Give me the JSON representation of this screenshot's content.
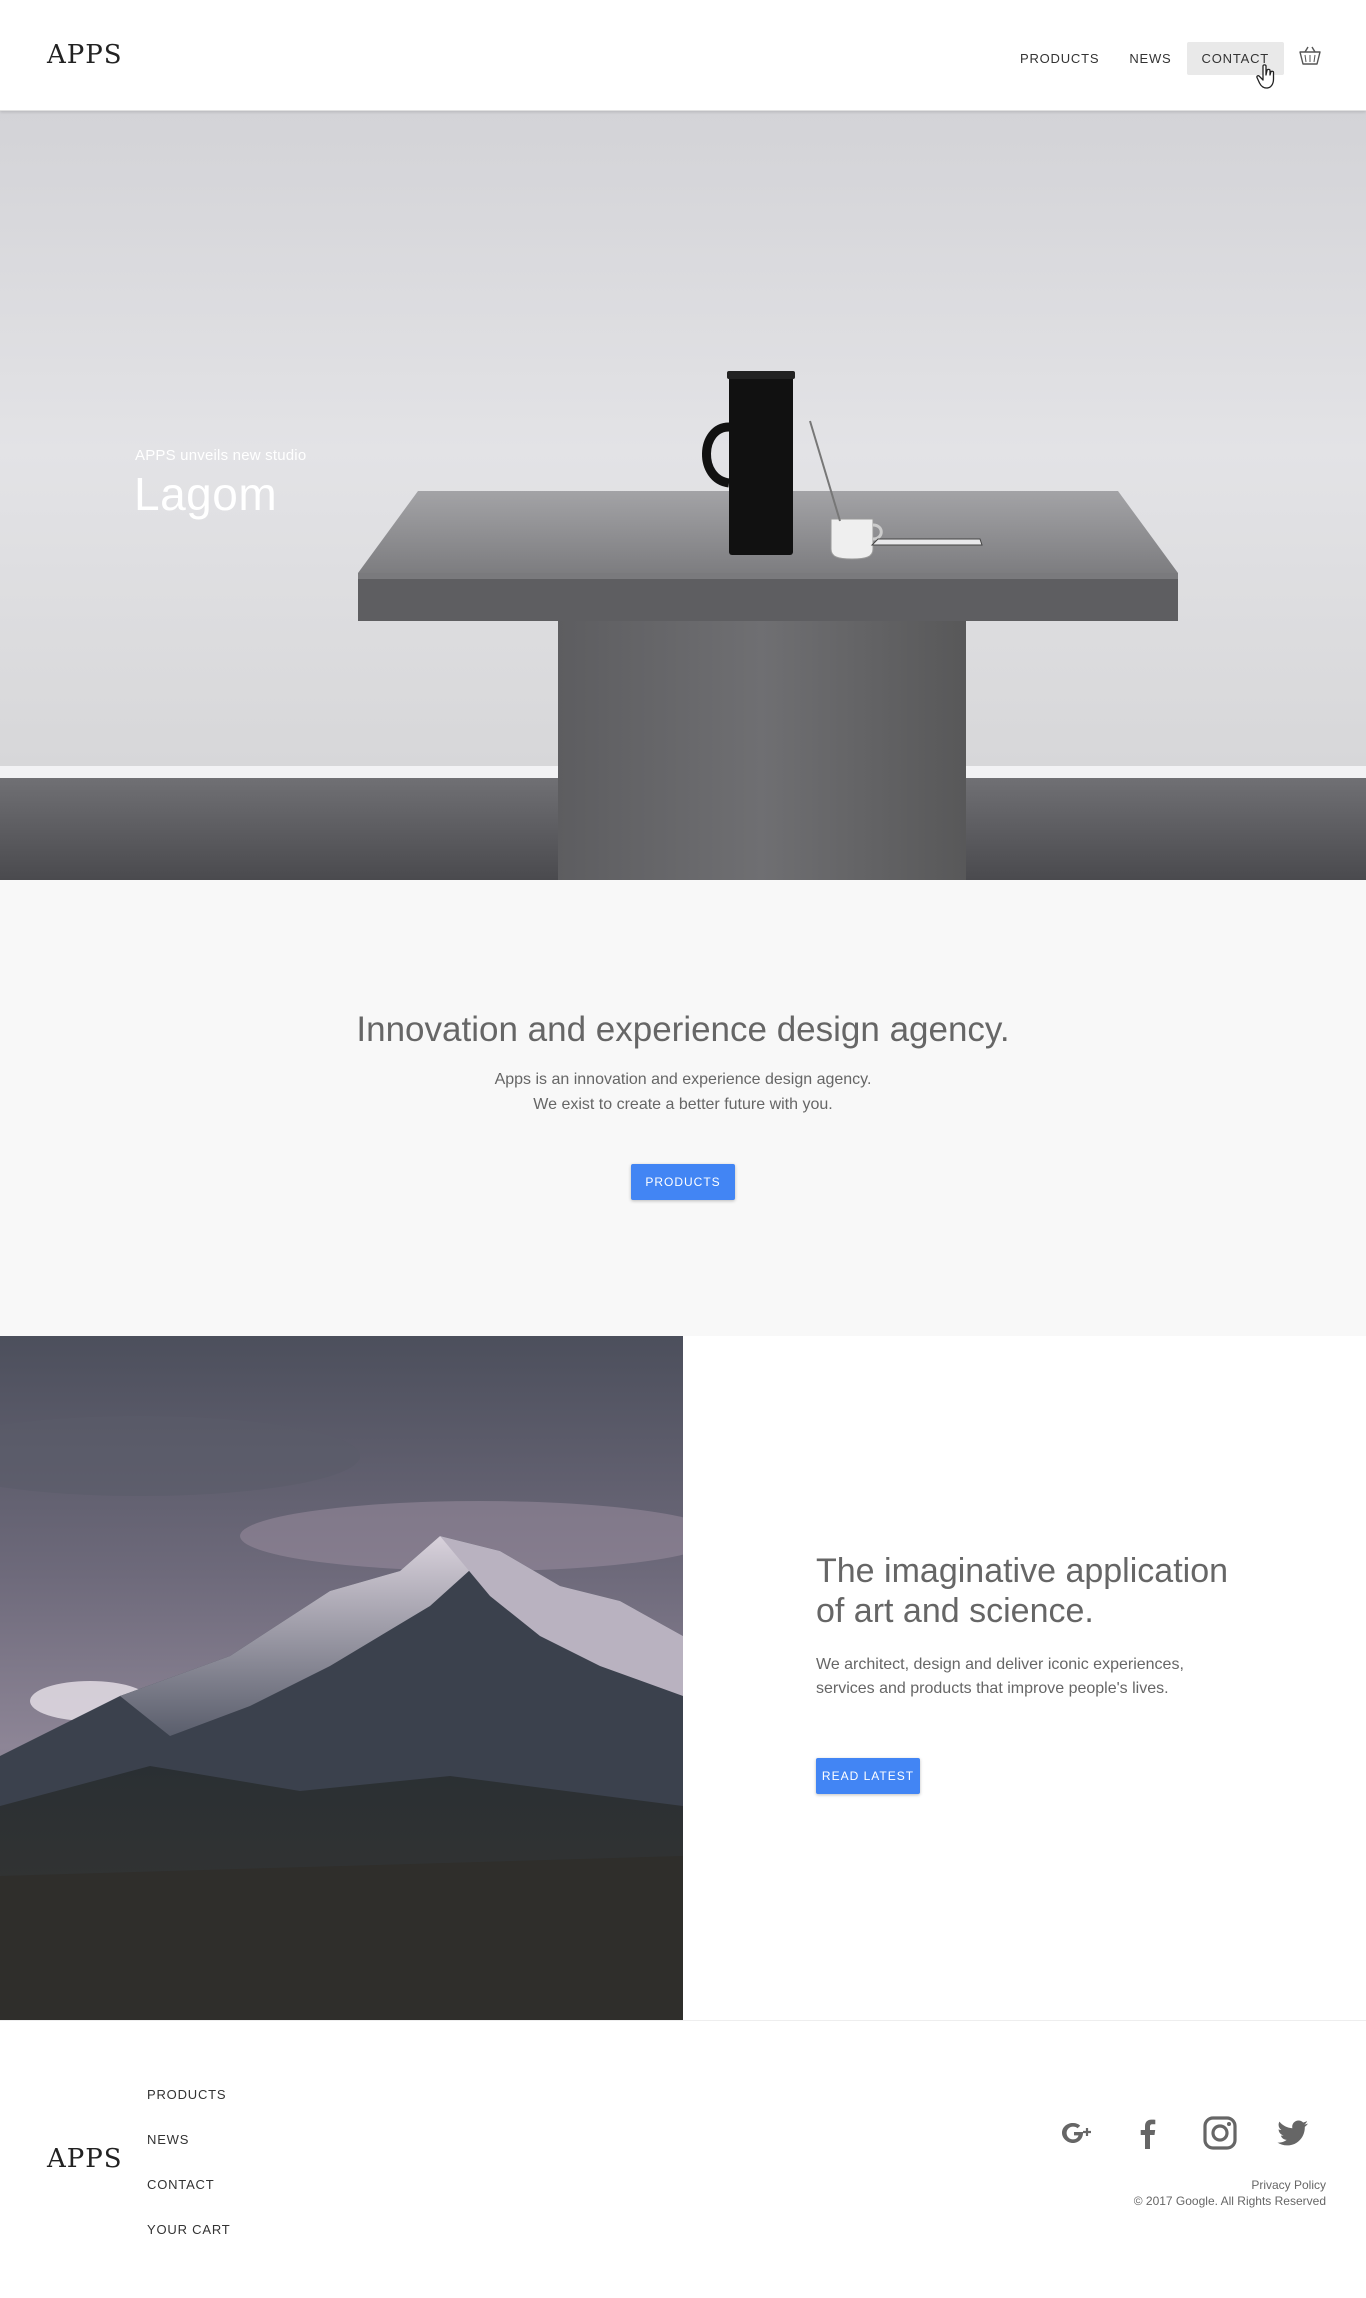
{
  "header": {
    "logo": "APPS",
    "nav": [
      {
        "label": "PRODUCTS"
      },
      {
        "label": "NEWS"
      },
      {
        "label": "CONTACT"
      }
    ],
    "cart_icon": "basket-icon",
    "cursor_icon": "hand-pointer-icon"
  },
  "hero": {
    "kicker": "APPS unveils new studio",
    "title": "Lagom"
  },
  "intro": {
    "title": "Innovation and experience design agency.",
    "line1": "Apps is an innovation and experience design agency.",
    "line2": "We exist to create a better future with you.",
    "button": "PRODUCTS"
  },
  "feature": {
    "title_line1": "The imaginative application",
    "title_line2": "of art and science.",
    "text_line1": "We architect, design and deliver iconic experiences,",
    "text_line2": "services and products that improve people's lives.",
    "button": "READ LATEST"
  },
  "footer": {
    "logo": "APPS",
    "links": [
      "PRODUCTS",
      "NEWS",
      "CONTACT",
      "YOUR CART"
    ],
    "social_icons": [
      "google-plus-icon",
      "facebook-icon",
      "instagram-icon",
      "twitter-icon"
    ],
    "privacy": "Privacy Policy",
    "copyright": "© 2017 Google. All Rights Reserved"
  },
  "colors": {
    "accent": "#4285f4",
    "footer_icon": "#666666",
    "intro_bg": "#f8f8f8"
  }
}
